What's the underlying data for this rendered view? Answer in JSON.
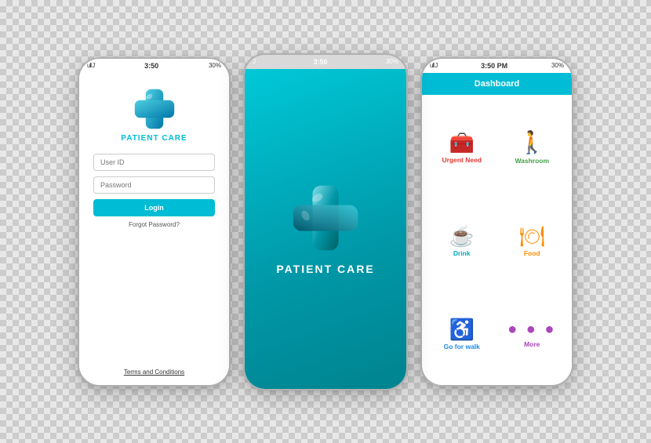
{
  "login": {
    "status_signal": "ull J",
    "status_time": "3:50",
    "status_battery": "30%",
    "app_name": "PATIENT CARE",
    "user_id_placeholder": "User ID",
    "password_placeholder": "Password",
    "login_label": "Login",
    "forgot_password": "Forgot Password?",
    "terms": "Terms  and Conditions"
  },
  "splash": {
    "status_signal": "J",
    "status_time": "3:50",
    "status_battery": "30%",
    "app_name": "PATIENT CARE"
  },
  "dashboard": {
    "status_signal": "ull J",
    "status_time": "3:50 PM",
    "status_battery": "30%",
    "header": "Dashboard",
    "items": [
      {
        "id": "urgent-need",
        "label": "Urgent Need",
        "color_class": "urgent",
        "icon": "🧰"
      },
      {
        "id": "washroom",
        "label": "Washroom",
        "color_class": "washroom",
        "icon": "🚶"
      },
      {
        "id": "drink",
        "label": "Drink",
        "color_class": "drink",
        "icon": "☕"
      },
      {
        "id": "food",
        "label": "Food",
        "color_class": "food",
        "icon": "🍽"
      },
      {
        "id": "walk",
        "label": "Go for walk",
        "color_class": "walk",
        "icon": "♿"
      },
      {
        "id": "more",
        "label": "More",
        "color_class": "more",
        "icon": "⋯"
      }
    ]
  }
}
